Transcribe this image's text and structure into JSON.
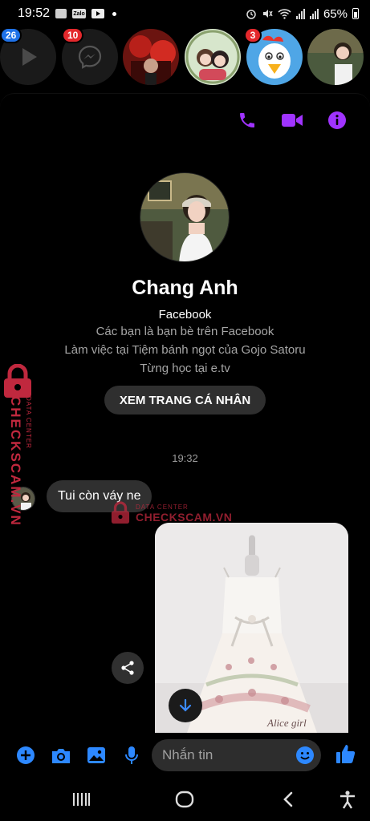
{
  "status_bar": {
    "time": "19:52",
    "battery": "65%"
  },
  "chat_heads": [
    {
      "badge": "26",
      "badge_color": "#1f72e8",
      "icon": "play-icon"
    },
    {
      "badge": "10",
      "badge_color": "#e4282c",
      "icon": "messenger-icon"
    },
    {
      "badge": "",
      "icon": "avatar-red-decor"
    },
    {
      "badge": "",
      "icon": "avatar-couple-cartoon"
    },
    {
      "badge": "3",
      "badge_color": "#e4282c",
      "icon": "avatar-chicken"
    },
    {
      "badge": "",
      "icon": "avatar-girl"
    }
  ],
  "top_actions": {
    "call": "phone-icon",
    "video": "video-icon",
    "info": "info-icon",
    "accent": "#a033ff"
  },
  "profile": {
    "name": "Chang Anh",
    "platform": "Facebook",
    "friends": "Các bạn là bạn bè trên Facebook",
    "work": "Làm việc tại Tiệm bánh ngọt của Gojo Satoru",
    "school": "Từng học tại e.tv",
    "view_profile": "XEM TRANG CÁ NHÂN"
  },
  "messages": {
    "timestamp": "19:32",
    "incoming_text": "Tui còn váy ne",
    "photo_caption": "Alice girl"
  },
  "composer": {
    "placeholder": "Nhắn tin",
    "accent": "#2d88ff"
  },
  "watermark": {
    "top": "DATA CENTER",
    "main": "CHECKSCAM.VN"
  }
}
